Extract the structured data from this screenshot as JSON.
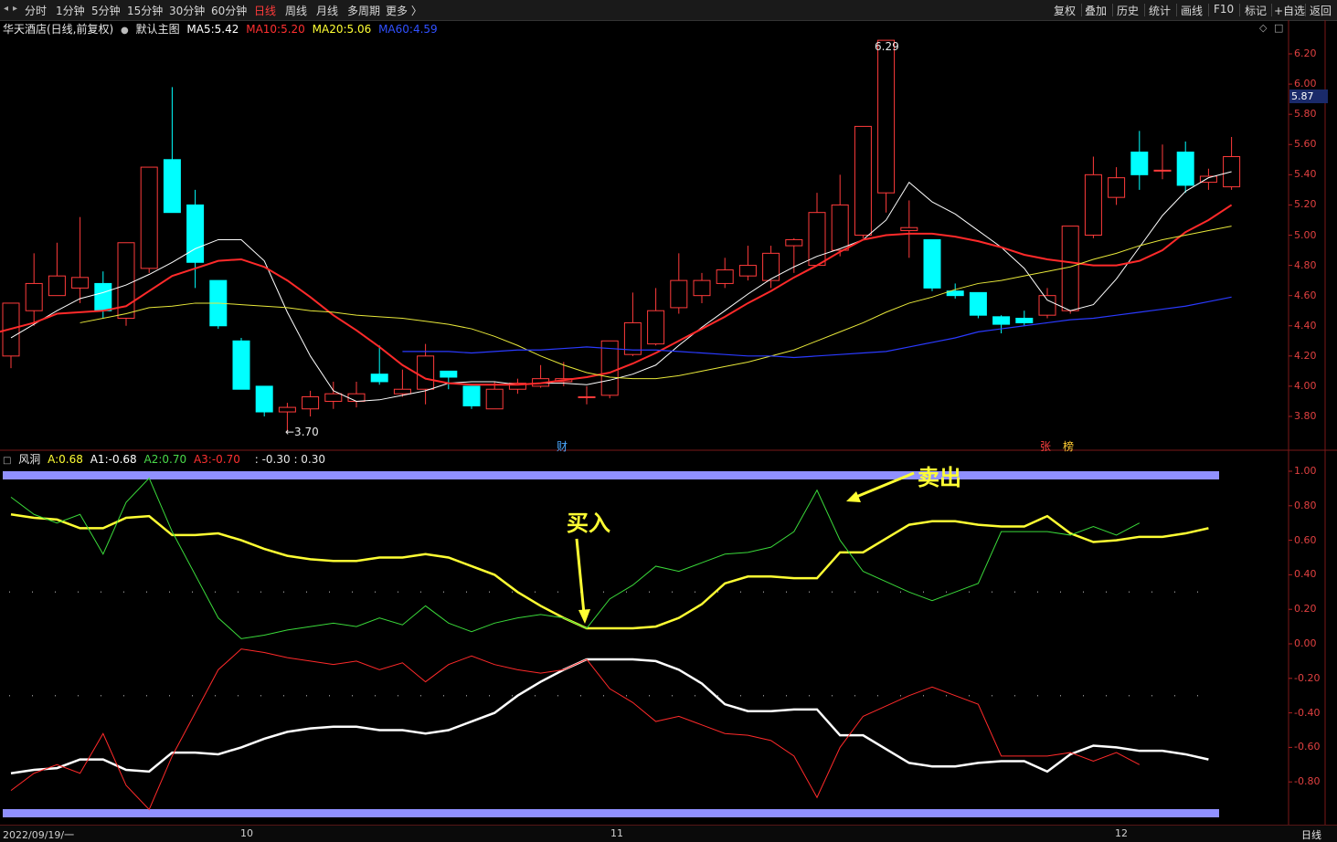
{
  "toolbar": {
    "periods": [
      {
        "label": "分时",
        "active": false
      },
      {
        "label": "1分钟",
        "active": false
      },
      {
        "label": "5分钟",
        "active": false
      },
      {
        "label": "15分钟",
        "active": false
      },
      {
        "label": "30分钟",
        "active": false
      },
      {
        "label": "60分钟",
        "active": false
      },
      {
        "label": "日线",
        "active": true
      },
      {
        "label": "周线",
        "active": false
      },
      {
        "label": "月线",
        "active": false
      },
      {
        "label": "多周期",
        "active": false
      },
      {
        "label": "更多 〉",
        "active": false
      }
    ],
    "right_buttons": [
      "复权",
      "叠加",
      "历史",
      "统计",
      "画线",
      "F10",
      "标记",
      "+自选",
      "返回"
    ]
  },
  "main_info": {
    "title": "华天酒店(日线,前复权)",
    "template_icon": "circle-icon",
    "template": "默认主图",
    "ma5_label": "MA5:",
    "ma5_value": "5.42",
    "ma10_label": "MA10:",
    "ma10_value": "5.20",
    "ma20_label": "MA20:",
    "ma20_value": "5.06",
    "ma60_label": "MA60:",
    "ma60_value": "4.59",
    "colors": {
      "ma5": "#ffffff",
      "ma10": "#ff3030",
      "ma20": "#ffff33",
      "ma60": "#3050ff"
    }
  },
  "osc_info": {
    "name": "风洞",
    "a_label": "A:",
    "a_value": "0.68",
    "a1_label": "A1:",
    "a1_value": "-0.68",
    "a2_label": "A2:",
    "a2_value": "0.70",
    "a3_label": "A3:",
    "a3_value": "-0.70",
    "extra": ": -0.30 : 0.30"
  },
  "price_axis": [
    "6.20",
    "6.00",
    "5.80",
    "5.60",
    "5.40",
    "5.20",
    "5.00",
    "4.80",
    "4.60",
    "4.40",
    "4.20",
    "4.00",
    "3.80"
  ],
  "current_price_tag": "5.87",
  "osc_axis": [
    "1.00",
    "0.80",
    "0.60",
    "0.40",
    "0.20",
    "0.00",
    "-0.20",
    "-0.40",
    "-0.60",
    "-0.80"
  ],
  "high_marker": "6.29",
  "low_marker": "←3.70",
  "event_markers": [
    {
      "label": "财",
      "color": "#4aa8ff"
    },
    {
      "label": "张",
      "color": "#ff4040"
    },
    {
      "label": "榜",
      "color": "#ffcc33"
    }
  ],
  "annotations": {
    "buy": "买入",
    "sell": "卖出"
  },
  "dates": [
    "2022/09/19/一",
    "10",
    "11",
    "12"
  ],
  "period_label": "日线",
  "chart_data": [
    {
      "type": "candlestick",
      "title": "华天酒店(日线,前复权)",
      "ylim": [
        3.7,
        6.3
      ],
      "candles": [
        {
          "o": 4.2,
          "c": 4.55,
          "h": 4.55,
          "l": 4.12
        },
        {
          "o": 4.5,
          "c": 4.68,
          "h": 4.88,
          "l": 4.4
        },
        {
          "o": 4.6,
          "c": 4.73,
          "h": 4.95,
          "l": 4.6
        },
        {
          "o": 4.65,
          "c": 4.72,
          "h": 5.12,
          "l": 4.55
        },
        {
          "o": 4.68,
          "c": 4.5,
          "h": 4.76,
          "l": 4.45
        },
        {
          "o": 4.45,
          "c": 4.95,
          "h": 4.95,
          "l": 4.4
        },
        {
          "o": 4.78,
          "c": 5.45,
          "h": 5.45,
          "l": 4.75
        },
        {
          "o": 5.5,
          "c": 5.15,
          "h": 5.98,
          "l": 5.15
        },
        {
          "o": 5.2,
          "c": 4.82,
          "h": 5.3,
          "l": 4.65
        },
        {
          "o": 4.7,
          "c": 4.4,
          "h": 4.7,
          "l": 4.38
        },
        {
          "o": 4.3,
          "c": 3.98,
          "h": 4.32,
          "l": 3.98
        },
        {
          "o": 4.0,
          "c": 3.83,
          "h": 4.0,
          "l": 3.8
        },
        {
          "o": 3.83,
          "c": 3.86,
          "h": 3.89,
          "l": 3.7
        },
        {
          "o": 3.85,
          "c": 3.93,
          "h": 3.97,
          "l": 3.8
        },
        {
          "o": 3.9,
          "c": 3.95,
          "h": 4.03,
          "l": 3.85
        },
        {
          "o": 3.9,
          "c": 3.95,
          "h": 4.03,
          "l": 3.86
        },
        {
          "o": 4.08,
          "c": 4.03,
          "h": 4.27,
          "l": 4.01
        },
        {
          "o": 3.95,
          "c": 3.98,
          "h": 4.11,
          "l": 3.93
        },
        {
          "o": 3.98,
          "c": 4.2,
          "h": 4.28,
          "l": 3.88
        },
        {
          "o": 4.1,
          "c": 4.06,
          "h": 4.1,
          "l": 3.98
        },
        {
          "o": 4.0,
          "c": 3.87,
          "h": 4.0,
          "l": 3.85
        },
        {
          "o": 3.85,
          "c": 3.98,
          "h": 4.03,
          "l": 3.85
        },
        {
          "o": 3.98,
          "c": 4.02,
          "h": 4.05,
          "l": 3.95
        },
        {
          "o": 4.0,
          "c": 4.05,
          "h": 4.14,
          "l": 3.99
        },
        {
          "o": 4.03,
          "c": 4.05,
          "h": 4.16,
          "l": 4.0
        },
        {
          "o": 3.93,
          "c": 3.93,
          "h": 4.0,
          "l": 3.88
        },
        {
          "o": 3.94,
          "c": 4.3,
          "h": 4.3,
          "l": 3.92
        },
        {
          "o": 4.21,
          "c": 4.42,
          "h": 4.62,
          "l": 4.2
        },
        {
          "o": 4.28,
          "c": 4.5,
          "h": 4.65,
          "l": 4.27
        },
        {
          "o": 4.52,
          "c": 4.7,
          "h": 4.88,
          "l": 4.48
        },
        {
          "o": 4.6,
          "c": 4.7,
          "h": 4.75,
          "l": 4.55
        },
        {
          "o": 4.68,
          "c": 4.77,
          "h": 4.85,
          "l": 4.65
        },
        {
          "o": 4.73,
          "c": 4.8,
          "h": 4.93,
          "l": 4.7
        },
        {
          "o": 4.7,
          "c": 4.88,
          "h": 4.93,
          "l": 4.65
        },
        {
          "o": 4.93,
          "c": 4.97,
          "h": 4.98,
          "l": 4.75
        },
        {
          "o": 4.8,
          "c": 5.15,
          "h": 5.28,
          "l": 4.8
        },
        {
          "o": 4.9,
          "c": 5.2,
          "h": 5.4,
          "l": 4.86
        },
        {
          "o": 5.0,
          "c": 5.72,
          "h": 5.72,
          "l": 4.98
        },
        {
          "o": 5.28,
          "c": 6.29,
          "h": 6.29,
          "l": 5.15
        },
        {
          "o": 5.03,
          "c": 5.05,
          "h": 5.23,
          "l": 4.85
        },
        {
          "o": 4.97,
          "c": 4.65,
          "h": 4.97,
          "l": 4.63
        },
        {
          "o": 4.63,
          "c": 4.6,
          "h": 4.68,
          "l": 4.58
        },
        {
          "o": 4.62,
          "c": 4.47,
          "h": 4.62,
          "l": 4.45
        },
        {
          "o": 4.46,
          "c": 4.41,
          "h": 4.47,
          "l": 4.35
        },
        {
          "o": 4.45,
          "c": 4.42,
          "h": 4.5,
          "l": 4.4
        },
        {
          "o": 4.47,
          "c": 4.6,
          "h": 4.65,
          "l": 4.45
        },
        {
          "o": 4.5,
          "c": 5.06,
          "h": 5.06,
          "l": 4.48
        },
        {
          "o": 5.0,
          "c": 5.4,
          "h": 5.52,
          "l": 4.98
        },
        {
          "o": 5.25,
          "c": 5.38,
          "h": 5.45,
          "l": 5.2
        },
        {
          "o": 5.55,
          "c": 5.4,
          "h": 5.69,
          "l": 5.3
        },
        {
          "o": 5.43,
          "c": 5.43,
          "h": 5.6,
          "l": 5.37
        },
        {
          "o": 5.55,
          "c": 5.33,
          "h": 5.62,
          "l": 5.28
        },
        {
          "o": 5.35,
          "c": 5.39,
          "h": 5.44,
          "l": 5.3
        },
        {
          "o": 5.32,
          "c": 5.52,
          "h": 5.65,
          "l": 5.3
        }
      ],
      "series": [
        {
          "name": "MA5",
          "values": [
            4.32,
            4.41,
            4.5,
            4.58,
            4.62,
            4.67,
            4.74,
            4.82,
            4.91,
            4.97,
            4.97,
            4.83,
            4.49,
            4.2,
            3.97,
            3.9,
            3.91,
            3.94,
            3.97,
            4.02,
            4.03,
            4.03,
            4.01,
            4.02,
            4.02,
            4.01,
            4.04,
            4.08,
            4.14,
            4.27,
            4.39,
            4.5,
            4.61,
            4.71,
            4.79,
            4.86,
            4.91,
            4.97,
            5.1,
            5.35,
            5.22,
            5.14,
            5.03,
            4.92,
            4.78,
            4.57,
            4.5,
            4.54,
            4.71,
            4.92,
            5.13,
            5.29,
            5.38,
            5.42
          ]
        },
        {
          "name": "MA10",
          "values": [
            4.3,
            4.34,
            4.38,
            4.42,
            4.48,
            4.49,
            4.5,
            4.53,
            4.63,
            4.73,
            4.78,
            4.83,
            4.84,
            4.79,
            4.7,
            4.59,
            4.47,
            4.37,
            4.26,
            4.14,
            4.05,
            4.02,
            4.01,
            4.01,
            4.01,
            4.02,
            4.04,
            4.06,
            4.09,
            4.15,
            4.22,
            4.3,
            4.38,
            4.46,
            4.55,
            4.63,
            4.72,
            4.8,
            4.89,
            4.97,
            5.0,
            5.01,
            5.01,
            4.99,
            4.96,
            4.92,
            4.87,
            4.84,
            4.82,
            4.8,
            4.8,
            4.83,
            4.9,
            5.02,
            5.1,
            5.2
          ]
        },
        {
          "name": "MA20",
          "values": [
            4.42,
            4.45,
            4.48,
            4.52,
            4.53,
            4.55,
            4.55,
            4.54,
            4.53,
            4.52,
            4.5,
            4.49,
            4.47,
            4.46,
            4.45,
            4.43,
            4.41,
            4.38,
            4.33,
            4.27,
            4.2,
            4.14,
            4.09,
            4.06,
            4.05,
            4.05,
            4.07,
            4.1,
            4.13,
            4.16,
            4.2,
            4.24,
            4.3,
            4.36,
            4.42,
            4.49,
            4.55,
            4.59,
            4.64,
            4.68,
            4.7,
            4.73,
            4.76,
            4.79,
            4.84,
            4.88,
            4.93,
            4.97,
            5.0,
            5.03,
            5.06
          ]
        },
        {
          "name": "MA60",
          "values": [
            4.23,
            4.23,
            4.23,
            4.22,
            4.23,
            4.24,
            4.24,
            4.25,
            4.26,
            4.25,
            4.24,
            4.24,
            4.23,
            4.22,
            4.21,
            4.2,
            4.2,
            4.19,
            4.2,
            4.21,
            4.22,
            4.23,
            4.26,
            4.29,
            4.32,
            4.36,
            4.38,
            4.4,
            4.42,
            4.44,
            4.45,
            4.47,
            4.49,
            4.51,
            4.53,
            4.56,
            4.59
          ]
        }
      ]
    },
    {
      "type": "line",
      "title": "风洞",
      "ylim": [
        -1.0,
        1.0
      ],
      "series": [
        {
          "name": "A",
          "values": [
            0.75,
            0.73,
            0.72,
            0.67,
            0.67,
            0.73,
            0.74,
            0.63,
            0.63,
            0.64,
            0.6,
            0.55,
            0.51,
            0.49,
            0.48,
            0.48,
            0.5,
            0.5,
            0.52,
            0.5,
            0.45,
            0.4,
            0.3,
            0.22,
            0.15,
            0.09,
            0.09,
            0.09,
            0.1,
            0.15,
            0.23,
            0.35,
            0.39,
            0.39,
            0.38,
            0.38,
            0.53,
            0.53,
            0.61,
            0.69,
            0.71,
            0.71,
            0.69,
            0.68,
            0.68,
            0.74,
            0.64,
            0.59,
            0.6,
            0.62,
            0.62,
            0.64,
            0.67
          ]
        },
        {
          "name": "A1",
          "values": [
            -0.75,
            -0.73,
            -0.72,
            -0.67,
            -0.67,
            -0.73,
            -0.74,
            -0.63,
            -0.63,
            -0.64,
            -0.6,
            -0.55,
            -0.51,
            -0.49,
            -0.48,
            -0.48,
            -0.5,
            -0.5,
            -0.52,
            -0.5,
            -0.45,
            -0.4,
            -0.3,
            -0.22,
            -0.15,
            -0.09,
            -0.09,
            -0.09,
            -0.1,
            -0.15,
            -0.23,
            -0.35,
            -0.39,
            -0.39,
            -0.38,
            -0.38,
            -0.53,
            -0.53,
            -0.61,
            -0.69,
            -0.71,
            -0.71,
            -0.69,
            -0.68,
            -0.68,
            -0.74,
            -0.64,
            -0.59,
            -0.6,
            -0.62,
            -0.62,
            -0.64,
            -0.67
          ]
        },
        {
          "name": "A2",
          "values": [
            0.85,
            0.75,
            0.7,
            0.75,
            0.52,
            0.82,
            0.96,
            0.65,
            0.4,
            0.15,
            0.03,
            0.05,
            0.08,
            0.1,
            0.12,
            0.1,
            0.15,
            0.11,
            0.22,
            0.12,
            0.07,
            0.12,
            0.15,
            0.17,
            0.15,
            0.09,
            0.26,
            0.34,
            0.45,
            0.42,
            0.47,
            0.52,
            0.53,
            0.56,
            0.65,
            0.89,
            0.6,
            0.42,
            0.36,
            0.3,
            0.25,
            0.3,
            0.35,
            0.65,
            0.65,
            0.65,
            0.63,
            0.68,
            0.63,
            0.7
          ]
        },
        {
          "name": "A3",
          "values": [
            -0.85,
            -0.75,
            -0.7,
            -0.75,
            -0.52,
            -0.82,
            -0.96,
            -0.65,
            -0.4,
            -0.15,
            -0.03,
            -0.05,
            -0.08,
            -0.1,
            -0.12,
            -0.1,
            -0.15,
            -0.11,
            -0.22,
            -0.12,
            -0.07,
            -0.12,
            -0.15,
            -0.17,
            -0.15,
            -0.09,
            -0.26,
            -0.34,
            -0.45,
            -0.42,
            -0.47,
            -0.52,
            -0.53,
            -0.56,
            -0.65,
            -0.89,
            -0.6,
            -0.42,
            -0.36,
            -0.3,
            -0.25,
            -0.3,
            -0.35,
            -0.65,
            -0.65,
            -0.65,
            -0.63,
            -0.68,
            -0.63,
            -0.7
          ]
        }
      ],
      "reference_lines": [
        0.3,
        -0.3,
        0.95,
        -0.95
      ]
    }
  ]
}
